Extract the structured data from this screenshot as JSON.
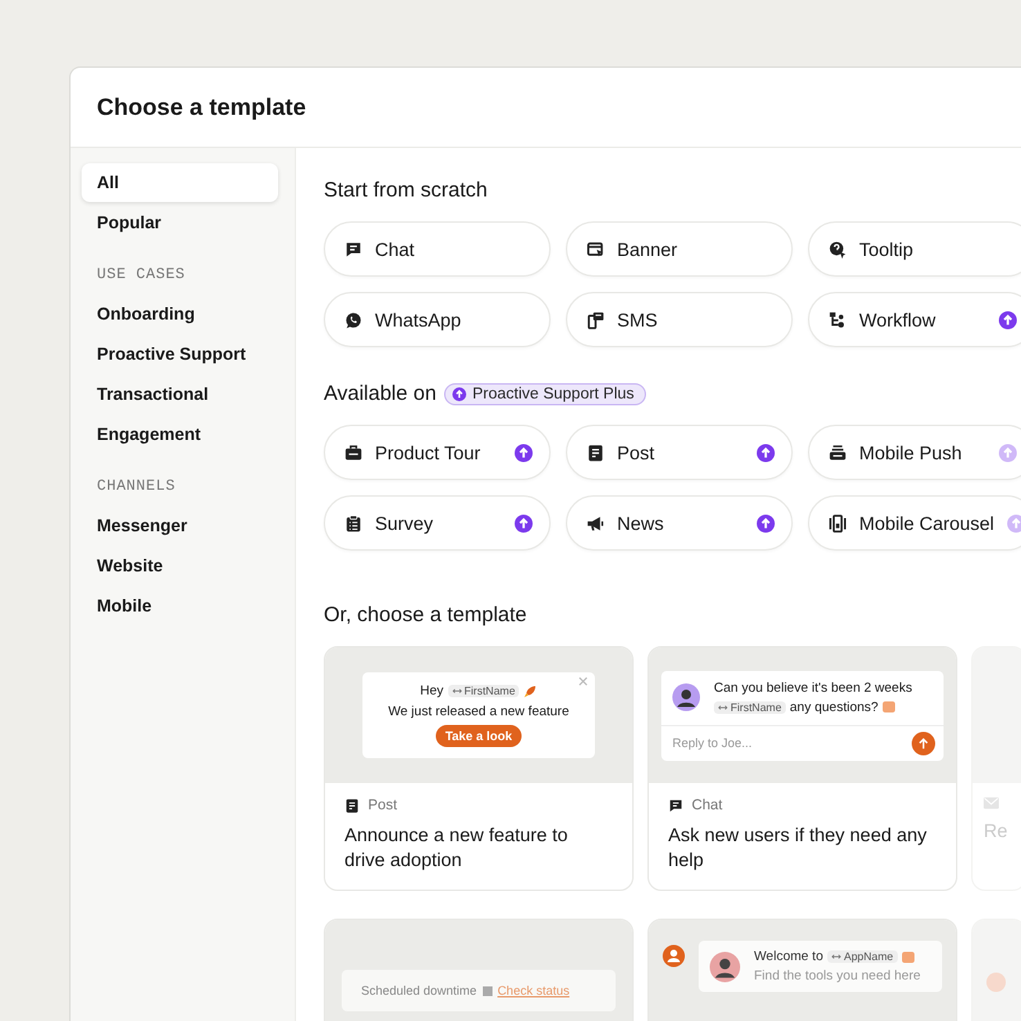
{
  "window": {
    "title": "Choose a template"
  },
  "sidebar": {
    "items": [
      {
        "kind": "item",
        "label": "All",
        "selected": true
      },
      {
        "kind": "item",
        "label": "Popular",
        "selected": false
      },
      {
        "kind": "heading",
        "label": "USE CASES"
      },
      {
        "kind": "item",
        "label": "Onboarding",
        "selected": false
      },
      {
        "kind": "item",
        "label": "Proactive Support",
        "selected": false
      },
      {
        "kind": "item",
        "label": "Transactional",
        "selected": false
      },
      {
        "kind": "item",
        "label": "Engagement",
        "selected": false
      },
      {
        "kind": "heading",
        "label": "CHANNELS"
      },
      {
        "kind": "item",
        "label": "Messenger",
        "selected": false
      },
      {
        "kind": "item",
        "label": "Website",
        "selected": false
      },
      {
        "kind": "item",
        "label": "Mobile",
        "selected": false
      }
    ]
  },
  "scratch": {
    "title": "Start from scratch",
    "items": [
      {
        "label": "Chat",
        "upgrade": false
      },
      {
        "label": "Banner",
        "upgrade": false
      },
      {
        "label": "Tooltip",
        "upgrade": false
      },
      {
        "label": "WhatsApp",
        "upgrade": false
      },
      {
        "label": "SMS",
        "upgrade": false
      },
      {
        "label": "Workflow",
        "upgrade": true
      }
    ]
  },
  "available": {
    "title": "Available on",
    "badge": "Proactive Support Plus",
    "items": [
      {
        "label": "Product Tour",
        "upgrade": true
      },
      {
        "label": "Post",
        "upgrade": true
      },
      {
        "label": "Mobile Push",
        "upgrade": true
      },
      {
        "label": "Survey",
        "upgrade": true
      },
      {
        "label": "News",
        "upgrade": true
      },
      {
        "label": "Mobile Carousel",
        "upgrade": true
      }
    ]
  },
  "templates": {
    "title": "Or, choose a template",
    "cards": [
      {
        "kind": "post",
        "greeting": "Hey",
        "token": "FirstName",
        "message": "We just released a new feature",
        "button": "Take a look",
        "type_label": "Post",
        "title": "Announce a new feature to drive adoption"
      },
      {
        "kind": "chat",
        "message": "Can you believe it's been 2 weeks",
        "token": "FirstName",
        "message_end": "any questions?",
        "placeholder": "Reply to Joe...",
        "type_label": "Chat",
        "title": "Ask new users if they need any help"
      },
      {
        "kind": "partial",
        "title": "Re"
      },
      {
        "kind": "banner",
        "message": "Scheduled downtime",
        "link": "Check status"
      },
      {
        "kind": "welcome",
        "message": "Welcome to",
        "token": "AppName",
        "subtitle": "Find the tools you need here"
      },
      {
        "kind": "blank"
      }
    ]
  }
}
